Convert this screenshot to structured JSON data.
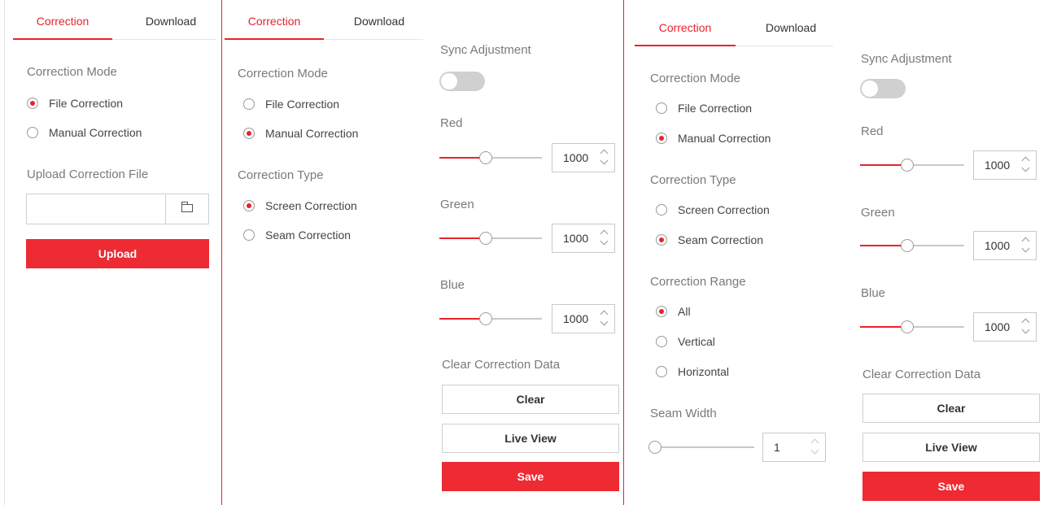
{
  "colors": {
    "accent": "#e8232b",
    "divider": "#e8232b",
    "text": "#333333",
    "muted": "#7a7a7a"
  },
  "panel1": {
    "tabs": {
      "correction": "Correction",
      "download": "Download"
    },
    "correction_mode": {
      "title": "Correction Mode",
      "file": "File Correction",
      "manual": "Manual Correction",
      "selected": "File Correction"
    },
    "upload_title": "Upload Correction File",
    "file_path_value": "",
    "upload_button": "Upload"
  },
  "panel2": {
    "tabs": {
      "correction": "Correction",
      "download": "Download"
    },
    "correction_mode": {
      "title": "Correction Mode",
      "file": "File Correction",
      "manual": "Manual Correction",
      "selected": "Manual Correction"
    },
    "correction_type": {
      "title": "Correction Type",
      "screen": "Screen Correction",
      "seam": "Seam Correction",
      "selected": "Screen Correction"
    },
    "sync_adjustment": {
      "label": "Sync Adjustment",
      "on": false
    },
    "red": {
      "label": "Red",
      "value": "1000",
      "level_percent": 45
    },
    "green": {
      "label": "Green",
      "value": "1000",
      "level_percent": 45
    },
    "blue": {
      "label": "Blue",
      "value": "1000",
      "level_percent": 45
    },
    "clear_data_title": "Clear Correction Data",
    "clear_button": "Clear",
    "live_view_button": "Live View",
    "save_button": "Save"
  },
  "panel3": {
    "tabs": {
      "correction": "Correction",
      "download": "Download"
    },
    "correction_mode": {
      "title": "Correction Mode",
      "file": "File Correction",
      "manual": "Manual Correction",
      "selected": "Manual Correction"
    },
    "correction_type": {
      "title": "Correction Type",
      "screen": "Screen Correction",
      "seam": "Seam Correction",
      "selected": "Seam Correction"
    },
    "correction_range": {
      "title": "Correction Range",
      "all": "All",
      "vertical": "Vertical",
      "horizontal": "Horizontal",
      "selected": "All"
    },
    "seam_width": {
      "label": "Seam Width",
      "value": "1",
      "level_percent": 0
    },
    "sync_adjustment": {
      "label": "Sync Adjustment",
      "on": false
    },
    "red": {
      "label": "Red",
      "value": "1000",
      "level_percent": 45
    },
    "green": {
      "label": "Green",
      "value": "1000",
      "level_percent": 45
    },
    "blue": {
      "label": "Blue",
      "value": "1000",
      "level_percent": 45
    },
    "clear_data_title": "Clear Correction Data",
    "clear_button": "Clear",
    "live_view_button": "Live View",
    "save_button": "Save"
  }
}
